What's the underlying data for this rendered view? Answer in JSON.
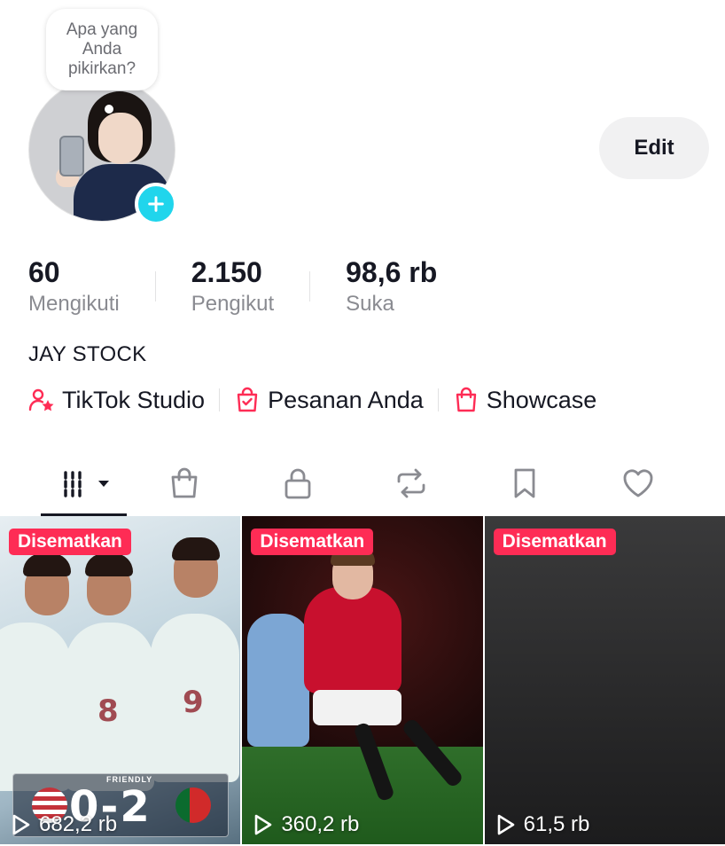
{
  "profile": {
    "bubble_text": "Apa yang Anda pikirkan?",
    "edit_label": "Edit",
    "username": "JAY STOCK"
  },
  "stats": [
    {
      "value": "60",
      "label": "Mengikuti"
    },
    {
      "value": "2.150",
      "label": "Pengikut"
    },
    {
      "value": "98,6 rb",
      "label": "Suka"
    }
  ],
  "links": [
    {
      "label": "TikTok Studio",
      "icon": "studio-icon"
    },
    {
      "label": "Pesanan Anda",
      "icon": "orders-bag-icon"
    },
    {
      "label": "Showcase",
      "icon": "showcase-bag-icon"
    }
  ],
  "tabs": [
    {
      "name": "videos-grid",
      "icon": "grid-icon",
      "active": true
    },
    {
      "name": "shop",
      "icon": "bag-icon",
      "active": false
    },
    {
      "name": "private",
      "icon": "lock-icon",
      "active": false
    },
    {
      "name": "reposts",
      "icon": "repost-icon",
      "active": false
    },
    {
      "name": "saved",
      "icon": "bookmark-icon",
      "active": false
    },
    {
      "name": "liked",
      "icon": "heart-icon",
      "active": false
    }
  ],
  "videos": [
    {
      "badge": "Disematkan",
      "views": "682,2 rb",
      "overlay_text": "FRIENDLY",
      "score": "0-2"
    },
    {
      "badge": "Disematkan",
      "views": "360,2 rb"
    },
    {
      "badge": "Disematkan",
      "views": "61,5 rb"
    }
  ],
  "colors": {
    "accent": "#fe2c55",
    "add_button": "#20d5ec",
    "text_primary": "#161823",
    "text_secondary": "#8a8b91"
  }
}
